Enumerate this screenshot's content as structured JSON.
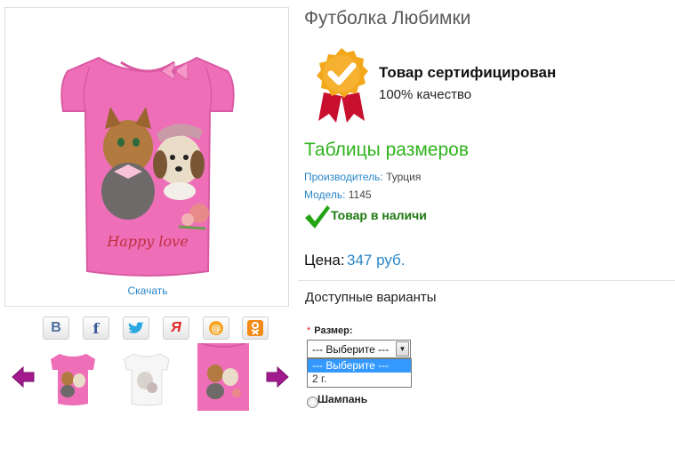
{
  "product": {
    "title": "Футболка Любимки",
    "image_print_text": "Happy love",
    "download_label": "Скачать"
  },
  "share_icons": [
    {
      "name": "vkontakte-icon",
      "glyph": "В",
      "color": "#4a6f9c"
    },
    {
      "name": "facebook-icon",
      "glyph": "f",
      "color": "#3b5998"
    },
    {
      "name": "twitter-icon",
      "glyph": "🐦",
      "color": "#2aa9e0"
    },
    {
      "name": "moi-krug-icon",
      "glyph": "Я",
      "color": "#e02424"
    },
    {
      "name": "mail-ru-icon",
      "glyph": "@",
      "color": "#f5a623"
    },
    {
      "name": "odnoklassniki-icon",
      "glyph": "ок",
      "color": "#f28a16"
    }
  ],
  "certificate": {
    "title": "Товар сертифицирован",
    "subtitle": "100% качество"
  },
  "size_table_link": "Таблицы размеров",
  "specs": {
    "manufacturer_label": "Производитель:",
    "manufacturer_value": "Турция",
    "model_label": "Модель:",
    "model_value": "1145"
  },
  "stock_status": "Товар в наличи",
  "price": {
    "label": "Цена:",
    "value": "347 руб."
  },
  "options": {
    "title": "Доступные варианты",
    "size_required_mark": "*",
    "size_label": "Размер:",
    "selected_value": "--- Выберите ---",
    "dropdown_options": [
      "--- Выберите ---",
      "2 г."
    ],
    "radio_label": "Шампань"
  },
  "colors": {
    "accent_blue": "#2a86c8",
    "accent_green": "#2fb31c",
    "stock_green": "#1d7a10",
    "shirt_pink": "#ee6fb8",
    "arrow_purple": "#a21a8e"
  }
}
